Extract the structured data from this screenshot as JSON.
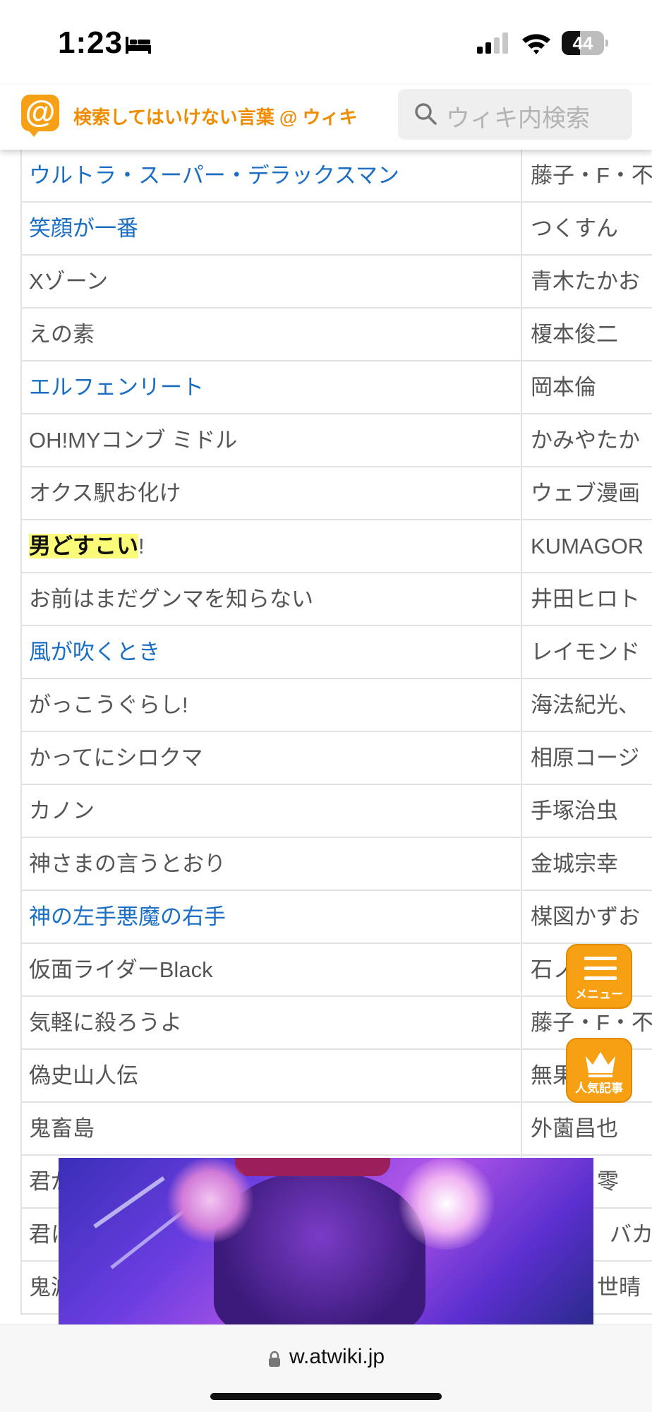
{
  "status_bar": {
    "time": "1:23",
    "battery": "44",
    "battery_level_percent": 44,
    "icons": [
      "bed-icon",
      "cellular-signal-icon",
      "wifi-icon",
      "battery-icon"
    ]
  },
  "header": {
    "logo_char": "@",
    "site_name": "検索してはいけない言葉 @ ウィキ",
    "search_placeholder": "ウィキ内検索",
    "accent_color": "#f5a015"
  },
  "table": {
    "rows": [
      {
        "title": "ウルトラ・スーパー・デラックスマン",
        "author": "藤子・F・不",
        "link": true
      },
      {
        "title": "笑顔が一番",
        "author": "つくすん",
        "link": true
      },
      {
        "title": "Xゾーン",
        "author": "青木たかお",
        "link": false
      },
      {
        "title": "えの素",
        "author": "榎本俊二",
        "link": false
      },
      {
        "title": "エルフェンリート",
        "author": "岡本倫",
        "link": true
      },
      {
        "title": "OH!MYコンブ ミドル",
        "author": "かみやたか",
        "link": false
      },
      {
        "title": "オクス駅お化け",
        "author": "ウェブ漫画",
        "link": false
      },
      {
        "title_highlight": "男どすこい",
        "title_rest": "!",
        "author": "KUMAGOR",
        "link": false
      },
      {
        "title": "お前はまだグンマを知らない",
        "author": "井田ヒロト",
        "link": false
      },
      {
        "title": "風が吹くとき",
        "author": "レイモンド",
        "link": true
      },
      {
        "title": "がっこうぐらし!",
        "author": "海法紀光、",
        "link": false
      },
      {
        "title": "かってにシロクマ",
        "author": "相原コージ",
        "link": false
      },
      {
        "title": "カノン",
        "author": "手塚治虫",
        "link": false
      },
      {
        "title": "神さまの言うとおり",
        "author": "金城宗幸",
        "link": false
      },
      {
        "title": "神の左手悪魔の右手",
        "author": "楳図かずお",
        "link": true
      },
      {
        "title": "仮面ライダーBlack",
        "author": "石ノ",
        "link": false
      },
      {
        "title": "気軽に殺ろうよ",
        "author": "藤子・F・不",
        "link": false
      },
      {
        "title": "偽史山人伝",
        "author": "無果",
        "link": false
      },
      {
        "title": "鬼畜島",
        "author": "外薗昌也",
        "link": false
      },
      {
        "title": "君が",
        "author": "零",
        "link": false
      },
      {
        "title": "君に",
        "author": "バカ",
        "link": false
      },
      {
        "title": "鬼滅",
        "author": "世晴",
        "link": false
      }
    ]
  },
  "fabs": {
    "menu_label": "メニュー",
    "ranking_label": "人気記事"
  },
  "bottom": {
    "url": "w.atwiki.jp"
  }
}
